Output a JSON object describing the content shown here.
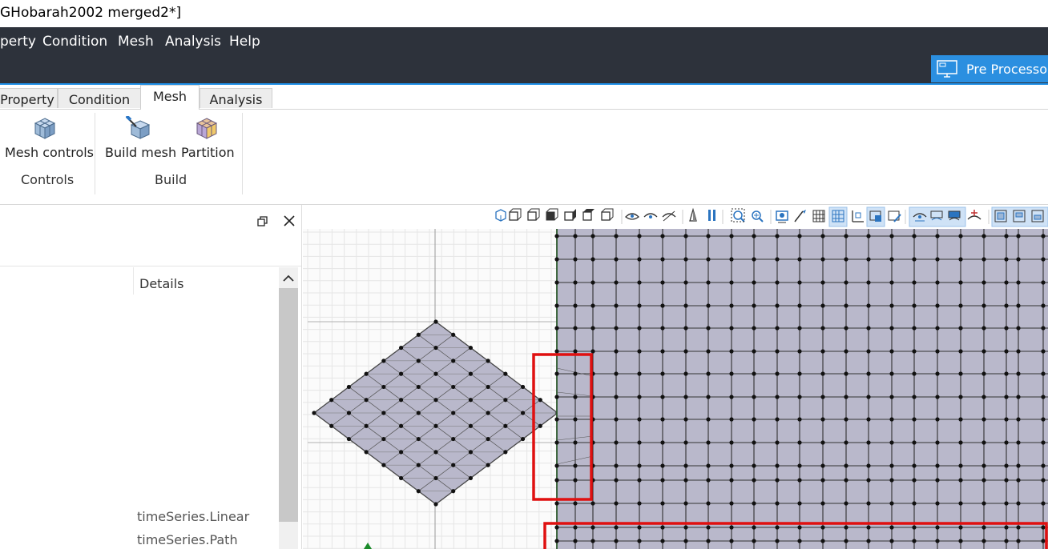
{
  "window": {
    "title": "GHobarah2002 merged2*]"
  },
  "menu": [
    "perty",
    "Condition",
    "Mesh",
    "Analysis",
    "Help"
  ],
  "mode_button": {
    "label": "Pre Processor",
    "icon": "monitor-icon"
  },
  "ribbon_tabs": [
    {
      "label": "Property",
      "active": false
    },
    {
      "label": "Condition",
      "active": false
    },
    {
      "label": "Mesh",
      "active": true
    },
    {
      "label": "Analysis",
      "active": false
    }
  ],
  "ribbon": {
    "groups": [
      {
        "label": "Controls",
        "buttons": [
          {
            "label": "Mesh controls",
            "icon": "mesh-controls-icon"
          }
        ]
      },
      {
        "label": "Build",
        "buttons": [
          {
            "label": "Build mesh",
            "icon": "build-mesh-icon"
          },
          {
            "label": "Partition",
            "icon": "partition-icon"
          }
        ]
      }
    ]
  },
  "panel": {
    "details_header": "Details",
    "items": [
      "timeSeries.Linear",
      "timeSeries.Path"
    ]
  },
  "colors": {
    "menubar": "#2d323b",
    "accent": "#2b8fe0",
    "mesh_fill": "#b9b8cb",
    "highlight": "#e01010"
  }
}
